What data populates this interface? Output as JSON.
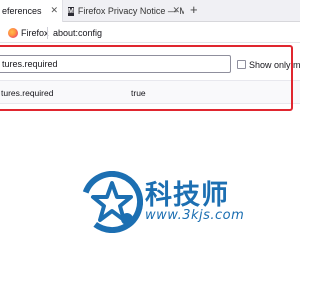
{
  "tabs": [
    {
      "title": "eferences",
      "active": true
    },
    {
      "title": "Firefox Privacy Notice — Mo",
      "favicon": "M",
      "active": false
    }
  ],
  "newtab_icon": "plus-icon",
  "urlbar": {
    "identity_label": "Firefox",
    "url": "about:config"
  },
  "config": {
    "search_value": "tures.required",
    "show_only_label": "Show only m",
    "pref": {
      "name": "tures.required",
      "value": "true"
    }
  },
  "watermark": {
    "title": "科技师",
    "url": "www.3kjs.com"
  },
  "colors": {
    "highlight": "#e0262f",
    "watermark": "#1c6fb2"
  }
}
